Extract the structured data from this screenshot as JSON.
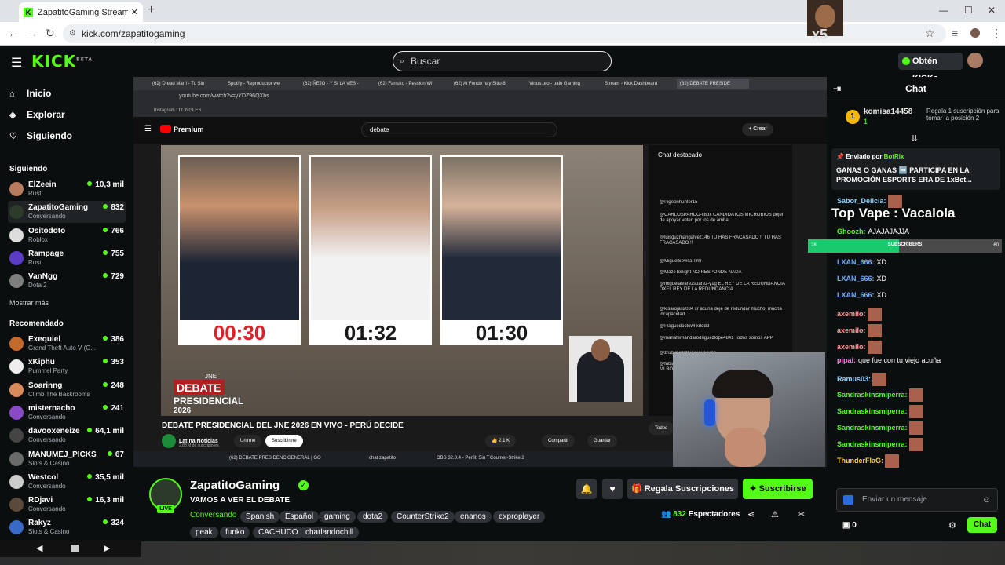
{
  "browser": {
    "tab_title": "ZapatitoGaming Stream - V",
    "url": "kick.com/zapatitogaming"
  },
  "kick": {
    "logo": "KICK",
    "logo_sup": "BETA",
    "search_placeholder": "Buscar",
    "kicks_button": "Obtén KICKs"
  },
  "sidebar": {
    "nav": [
      {
        "label": "Inicio",
        "icon": "home-icon"
      },
      {
        "label": "Explorar",
        "icon": "compass-icon"
      },
      {
        "label": "Siguiendo",
        "icon": "heart-icon"
      }
    ],
    "following_title": "Siguiendo",
    "following": [
      {
        "name": "ElZeein",
        "category": "Rust",
        "viewers": "10,3 mil",
        "color": "#b87b5d"
      },
      {
        "name": "ZapatitoGaming",
        "category": "Conversando",
        "viewers": "832",
        "color": "#2e3b2a"
      },
      {
        "name": "Ositodoto",
        "category": "Roblox",
        "viewers": "766",
        "color": "#dddddd"
      },
      {
        "name": "Rampage",
        "category": "Rust",
        "viewers": "755",
        "color": "#5a3cc7"
      },
      {
        "name": "VanNgg",
        "category": "Dota 2",
        "viewers": "729",
        "color": "#7e7e7e"
      }
    ],
    "show_more": "Mostrar más",
    "recommended_title": "Recomendado",
    "recommended": [
      {
        "name": "Exequiel",
        "category": "Grand Theft Auto V (G...",
        "viewers": "386",
        "color": "#c46a2a"
      },
      {
        "name": "xKiphu",
        "category": "Pummel Party",
        "viewers": "353",
        "color": "#eeeeee"
      },
      {
        "name": "Soarinng",
        "category": "Climb The Backrooms",
        "viewers": "248",
        "color": "#d88a5a"
      },
      {
        "name": "misternacho",
        "category": "Conversando",
        "viewers": "241",
        "color": "#8a4ac7"
      },
      {
        "name": "davooxeneize",
        "category": "Conversando",
        "viewers": "64,1 mil",
        "color": "#444444"
      },
      {
        "name": "MANUMEJ_PICKS",
        "category": "Slots & Casino",
        "viewers": "67",
        "color": "#6a6a6a"
      },
      {
        "name": "Westcol",
        "category": "Conversando",
        "viewers": "35,5 mil",
        "color": "#cccccc"
      },
      {
        "name": "RDjavi",
        "category": "Conversando",
        "viewers": "16,3 mil",
        "color": "#5b4a3a"
      },
      {
        "name": "Rakyz",
        "category": "Slots & Casino",
        "viewers": "324",
        "color": "#3a6ac7"
      }
    ]
  },
  "video": {
    "inner_tabs": [
      "(62) Dread Mar I - Tu Sin",
      "Spotify - Reproductor we",
      "(62) ÑEJO - Y SI LA VES -",
      "(62) Farruko - Pession Wi",
      "(62) Al Fondo hay Sitio 8",
      "Virtus.pro - pain Gaming",
      "Stream - Kick Dashboard",
      "(62) DEBATE PRESIDE"
    ],
    "inner_url": "youtube.com/watch?v=yYDZ96QXbs",
    "bookmarks": "Instagram   f   f   f   INGLES",
    "yt_logo": "Premium",
    "yt_search": "debate",
    "yt_create": "+ Crear",
    "timers": [
      "00:30",
      "01:32",
      "01:30"
    ],
    "debate_logo": [
      "JNE",
      "DEBATE",
      "PRESIDENCIAL",
      "2026"
    ],
    "chat_title": "Chat destacado",
    "chat_lines": [
      "@Pigeonhunter15",
      "@CARLOSPARCO-c8bx CANDIDATOS MICROBIOS dejen de apoyar voten por los de amba",
      "@luisguzmangalvez146 TU HAS FRACASADO !! TU HAS FRACASADO !!",
      "@MiguelSevilla Tmr",
      "@MazeTonight NO RESPONDE NADA",
      "@miguelalvarezsuarez-y1g EL REY DE LA REDUNDANCIA DXEL REY DE LA REDUNDANCIA",
      "@kisarojas2034 xr acuña deje de redundar mucho, mucha incapacidad",
      "@Plaguedoctowl xdddd",
      "@mariafernandarodriguezlope4841 Todos somos APP",
      "@zrubyruiz29 jajajaj acuña",
      "@fabianorozabache4332 ACUÑA, BÁJALE LA PENSION A MI BOTISITAAAA"
    ],
    "title": "DEBATE PRESIDENCIAL DEL JNE 2026 EN VIVO - PERÚ DECIDE",
    "channel": "Latina Noticias",
    "subs": "2,88 M de suscriptores",
    "btn_unirme": "Unirme",
    "btn_suscribirme": "Suscribirme",
    "likes": "2,1 K",
    "btn_share": "Compartir",
    "btn_save": "Guardar",
    "taskbar_items": [
      "(62) DEBATE PRESIDENC",
      "GENERAL | GO",
      "chat zapatito",
      "OBS 32.0.4 - Perfil: Sin T",
      "Counter-Strike 2"
    ],
    "chat_button": "Todos"
  },
  "stream": {
    "name": "ZapatitoGaming",
    "live": "LIVE",
    "title": "VAMOS A VER EL DEBATE",
    "category": "Conversando",
    "tags": [
      "Spanish",
      "Español",
      "gaming",
      "dota2",
      "CounterStrike2",
      "enanos",
      "exproplayer",
      "peak",
      "funko",
      "CACHUDO",
      "charlandochill"
    ],
    "gift_button": "Regala Suscripciones",
    "subscribe_button": "Suscribirse",
    "viewers": "832",
    "viewers_label": "Espectadores"
  },
  "chat": {
    "title": "Chat",
    "leader": {
      "rank": "1",
      "user": "komisa14458",
      "count": "1",
      "gift_text": "Regala 1 suscripción para tomar la posición 2"
    },
    "pinned_by_label": "Enviado por",
    "pinned_by": "BotRix",
    "pinned_msg": "GANAS O GANAS ➡️ PARTICIPA EN LA PROMOCIÓN ESPORTS ERA DE 1xBet...",
    "overlay_name": "Top Vape : Vacalola",
    "sub_goal": {
      "label": "SUBSCRIBERS",
      "current": "28",
      "target": "60",
      "fraction": 0.47
    },
    "messages": [
      {
        "user": "Sabor_Delicia:",
        "text": "",
        "color": "#8fd3ff",
        "emote": true
      },
      {
        "user": "Ghoozh:",
        "text": "AJAJAJAJJA",
        "color": "#53fc18",
        "emote": false
      },
      {
        "user": "LXAN_666:",
        "text": "XD",
        "color": "#6fa8ff",
        "emote": false
      },
      {
        "user": "LXAN_666:",
        "text": "XD",
        "color": "#6fa8ff",
        "emote": false
      },
      {
        "user": "LXAN_666:",
        "text": "XD",
        "color": "#6fa8ff",
        "emote": false
      },
      {
        "user": "axemilo:",
        "text": "",
        "color": "#ff9a9a",
        "emote": true
      },
      {
        "user": "axemilo:",
        "text": "",
        "color": "#ff9a9a",
        "emote": true
      },
      {
        "user": "axemilo:",
        "text": "",
        "color": "#ff9a9a",
        "emote": true
      },
      {
        "user": "pipai:",
        "text": "que fue con tu viejo acuña",
        "color": "#ff7ad9",
        "emote": false
      },
      {
        "user": "Ramus03:",
        "text": "",
        "color": "#8fd3ff",
        "emote": true
      },
      {
        "user": "Sandraskinsmiperra:",
        "text": "",
        "color": "#53fc18",
        "emote": true
      },
      {
        "user": "Sandraskinsmiperra:",
        "text": "",
        "color": "#53fc18",
        "emote": true
      },
      {
        "user": "Sandraskinsmiperra:",
        "text": "",
        "color": "#53fc18",
        "emote": true
      },
      {
        "user": "Sandraskinsmiperra:",
        "text": "",
        "color": "#53fc18",
        "emote": true
      },
      {
        "user": "ThunderFlaG:",
        "text": "",
        "color": "#ffd23f",
        "emote": true
      }
    ],
    "input_placeholder": "Enviar un mensaje",
    "points": "0",
    "send_button": "Chat"
  }
}
